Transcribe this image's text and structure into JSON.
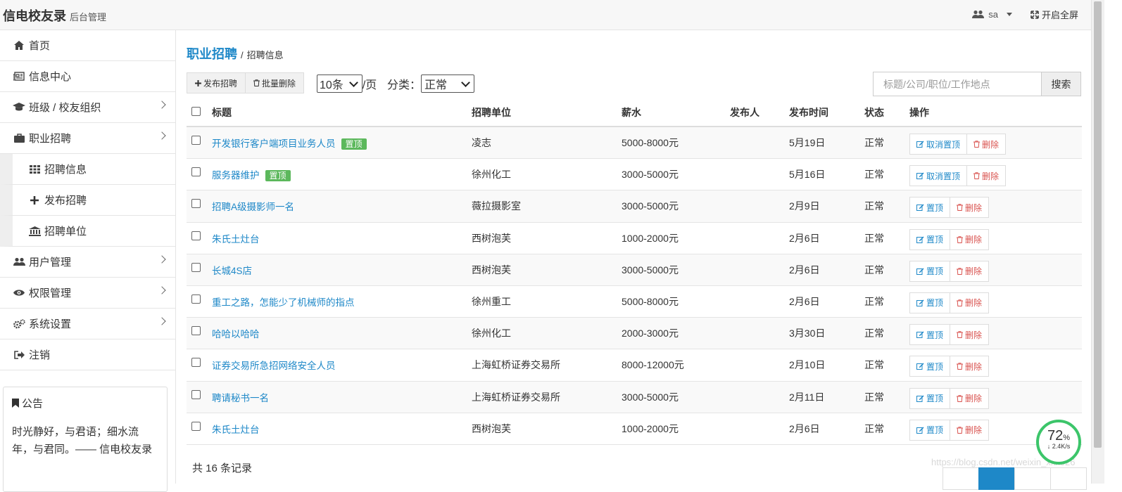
{
  "header": {
    "brand": "信电校友录",
    "brand_sub": "后台管理",
    "user": "sa",
    "fullscreen": "开启全屏"
  },
  "sidebar": {
    "items": [
      {
        "label": "首页",
        "icon": "home-icon"
      },
      {
        "label": "信息中心",
        "icon": "newspaper-icon"
      },
      {
        "label": "班级 / 校友组织",
        "icon": "graduation-cap-icon"
      },
      {
        "label": "职业招聘",
        "icon": "briefcase-icon"
      },
      {
        "label": "招聘信息",
        "icon": "grid-icon"
      },
      {
        "label": "发布招聘",
        "icon": "plus-icon"
      },
      {
        "label": "招聘单位",
        "icon": "bank-icon"
      },
      {
        "label": "用户管理",
        "icon": "users-icon"
      },
      {
        "label": "权限管理",
        "icon": "eye-icon"
      },
      {
        "label": "系统设置",
        "icon": "cogs-icon"
      },
      {
        "label": "注销",
        "icon": "logout-icon"
      }
    ],
    "notice_title": "公告",
    "notice_body": "时光静好，与君语；细水流年，与君同。—— 信电校友录"
  },
  "breadcrumb": {
    "section": "职业招聘",
    "sep": "/",
    "page": "招聘信息"
  },
  "toolbar": {
    "publish_label": "发布招聘",
    "batch_delete_label": "批量删除",
    "page_size": "10条",
    "per_page_suffix": "/页",
    "category_label": "分类：",
    "category_value": "正常",
    "search_placeholder": "标题/公司/职位/工作地点",
    "search_button": "搜索"
  },
  "table": {
    "headers": {
      "title": "标题",
      "unit": "招聘单位",
      "salary": "薪水",
      "publisher": "发布人",
      "time": "发布时间",
      "status": "状态",
      "ops": "操作"
    },
    "rows": [
      {
        "title": "开发银行客户端项目业务人员",
        "badge": "置顶",
        "unit": "凌志",
        "salary": "5000-8000元",
        "publisher": "",
        "time": "5月19日",
        "status": "正常",
        "op1": "取消置顶",
        "op2": "删除"
      },
      {
        "title": "服务器维护",
        "badge": "置顶",
        "unit": "徐州化工",
        "salary": "3000-5000元",
        "publisher": "",
        "time": "5月16日",
        "status": "正常",
        "op1": "取消置顶",
        "op2": "删除"
      },
      {
        "title": "招聘A级摄影师一名",
        "badge": "",
        "unit": "薇拉摄影室",
        "salary": "3000-5000元",
        "publisher": "",
        "time": "2月9日",
        "status": "正常",
        "op1": "置顶",
        "op2": "删除"
      },
      {
        "title": "朱氏土灶台",
        "badge": "",
        "unit": "西树泡芙",
        "salary": "1000-2000元",
        "publisher": "",
        "time": "2月6日",
        "status": "正常",
        "op1": "置顶",
        "op2": "删除"
      },
      {
        "title": "长城4S店",
        "badge": "",
        "unit": "西树泡芙",
        "salary": "3000-5000元",
        "publisher": "",
        "time": "2月6日",
        "status": "正常",
        "op1": "置顶",
        "op2": "删除"
      },
      {
        "title": "重工之路，怎能少了机械师的指点",
        "badge": "",
        "unit": "徐州重工",
        "salary": "5000-8000元",
        "publisher": "",
        "time": "2月6日",
        "status": "正常",
        "op1": "置顶",
        "op2": "删除"
      },
      {
        "title": "哈哈以哈哈",
        "badge": "",
        "unit": "徐州化工",
        "salary": "2000-3000元",
        "publisher": "",
        "time": "3月30日",
        "status": "正常",
        "op1": "置顶",
        "op2": "删除"
      },
      {
        "title": "证券交易所急招网络安全人员",
        "badge": "",
        "unit": "上海虹桥证券交易所",
        "salary": "8000-12000元",
        "publisher": "",
        "time": "2月10日",
        "status": "正常",
        "op1": "置顶",
        "op2": "删除"
      },
      {
        "title": "聘请秘书一名",
        "badge": "",
        "unit": "上海虹桥证券交易所",
        "salary": "3000-5000元",
        "publisher": "",
        "time": "2月11日",
        "status": "正常",
        "op1": "置顶",
        "op2": "删除"
      },
      {
        "title": "朱氏土灶台",
        "badge": "",
        "unit": "西树泡芙",
        "salary": "1000-2000元",
        "publisher": "",
        "time": "2月6日",
        "status": "正常",
        "op1": "置顶",
        "op2": "删除"
      }
    ],
    "total": "共 16 条记录"
  },
  "widget": {
    "percent": "72",
    "percent_sign": "%",
    "speed": "2.4K/s"
  },
  "watermark": "https://blog.csdn.net/weixin_xxx526",
  "colors": {
    "accent": "#1e88c8",
    "badge": "#5cb85c",
    "danger": "#d9534f",
    "gauge": "#3cc56a"
  }
}
